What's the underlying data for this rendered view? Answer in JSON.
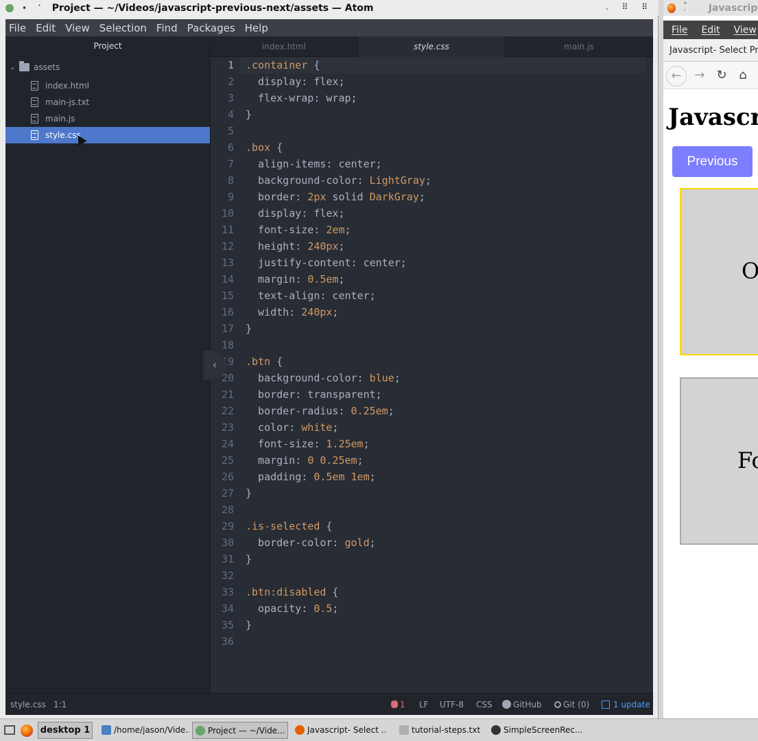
{
  "atom": {
    "title": "Project — ~/Videos/javascript-previous-next/assets — Atom",
    "menu": [
      "File",
      "Edit",
      "View",
      "Selection",
      "Find",
      "Packages",
      "Help"
    ],
    "tree_header": "Project",
    "folder": "assets",
    "files": [
      "index.html",
      "main-js.txt",
      "main.js",
      "style.css"
    ],
    "selected_file": "style.css",
    "tabs": [
      "index.html",
      "style.css",
      "main.js"
    ],
    "active_tab": "style.css",
    "status": {
      "file": "style.css",
      "position": "1:1",
      "issues": "1",
      "line_ending": "LF",
      "encoding": "UTF-8",
      "grammar": "CSS",
      "github": "GitHub",
      "git": "Git (0)",
      "update": "1 update"
    }
  },
  "code": [
    [
      [
        "sel",
        ".container"
      ],
      [
        "prop",
        " {"
      ]
    ],
    [
      [
        "prop",
        "  display: flex;"
      ]
    ],
    [
      [
        "prop",
        "  flex-wrap: wrap;"
      ]
    ],
    [
      [
        "prop",
        "}"
      ]
    ],
    [],
    [
      [
        "sel",
        ".box"
      ],
      [
        "prop",
        " {"
      ]
    ],
    [
      [
        "prop",
        "  align-items: center;"
      ]
    ],
    [
      [
        "prop",
        "  background-color: "
      ],
      [
        "val",
        "LightGray"
      ],
      [
        "prop",
        ";"
      ]
    ],
    [
      [
        "prop",
        "  border: "
      ],
      [
        "val",
        "2px"
      ],
      [
        "prop",
        " solid "
      ],
      [
        "val",
        "DarkGray"
      ],
      [
        "prop",
        ";"
      ]
    ],
    [
      [
        "prop",
        "  display: flex;"
      ]
    ],
    [
      [
        "prop",
        "  font-size: "
      ],
      [
        "val",
        "2em"
      ],
      [
        "prop",
        ";"
      ]
    ],
    [
      [
        "prop",
        "  height: "
      ],
      [
        "val",
        "240px"
      ],
      [
        "prop",
        ";"
      ]
    ],
    [
      [
        "prop",
        "  justify-content: center;"
      ]
    ],
    [
      [
        "prop",
        "  margin: "
      ],
      [
        "val",
        "0.5em"
      ],
      [
        "prop",
        ";"
      ]
    ],
    [
      [
        "prop",
        "  text-align: center;"
      ]
    ],
    [
      [
        "prop",
        "  width: "
      ],
      [
        "val",
        "240px"
      ],
      [
        "prop",
        ";"
      ]
    ],
    [
      [
        "prop",
        "}"
      ]
    ],
    [],
    [
      [
        "sel",
        ".btn"
      ],
      [
        "prop",
        " {"
      ]
    ],
    [
      [
        "prop",
        "  background-color: "
      ],
      [
        "val",
        "blue"
      ],
      [
        "prop",
        ";"
      ]
    ],
    [
      [
        "prop",
        "  border: transparent;"
      ]
    ],
    [
      [
        "prop",
        "  border-radius: "
      ],
      [
        "val",
        "0.25em"
      ],
      [
        "prop",
        ";"
      ]
    ],
    [
      [
        "prop",
        "  color: "
      ],
      [
        "val",
        "white"
      ],
      [
        "prop",
        ";"
      ]
    ],
    [
      [
        "prop",
        "  font-size: "
      ],
      [
        "val",
        "1.25em"
      ],
      [
        "prop",
        ";"
      ]
    ],
    [
      [
        "prop",
        "  margin: "
      ],
      [
        "val",
        "0 0.25em"
      ],
      [
        "prop",
        ";"
      ]
    ],
    [
      [
        "prop",
        "  padding: "
      ],
      [
        "val",
        "0.5em 1em"
      ],
      [
        "prop",
        ";"
      ]
    ],
    [
      [
        "prop",
        "}"
      ]
    ],
    [],
    [
      [
        "sel",
        ".is-selected"
      ],
      [
        "prop",
        " {"
      ]
    ],
    [
      [
        "prop",
        "  border-color: "
      ],
      [
        "val",
        "gold"
      ],
      [
        "prop",
        ";"
      ]
    ],
    [
      [
        "prop",
        "}"
      ]
    ],
    [],
    [
      [
        "sel",
        ".btn:disabled"
      ],
      [
        "prop",
        " {"
      ]
    ],
    [
      [
        "prop",
        "  opacity: "
      ],
      [
        "val",
        "0.5"
      ],
      [
        "prop",
        ";"
      ]
    ],
    [
      [
        "prop",
        "}"
      ]
    ],
    []
  ],
  "firefox": {
    "title": "Javascript",
    "menu": [
      "File",
      "Edit",
      "View"
    ],
    "tab_title": "Javascript- Select Pr",
    "page_heading": "Javascript",
    "prev_button": "Previous",
    "box1_text": "O",
    "box2_text": "Fo"
  },
  "taskbar": {
    "desktop": "desktop 1",
    "items": [
      "/home/jason/Vide...",
      "Project — ~/Vide...",
      "Javascript- Select ...",
      "tutorial-steps.txt",
      "SimpleScreenRec..."
    ]
  },
  "colors": {
    "editor_bg": "#282c34",
    "tree_bg": "#21252b",
    "selection": "#4d78cc",
    "value": "#d19a66",
    "button_purple": "#7d7dff",
    "gold": "#ffd700"
  }
}
